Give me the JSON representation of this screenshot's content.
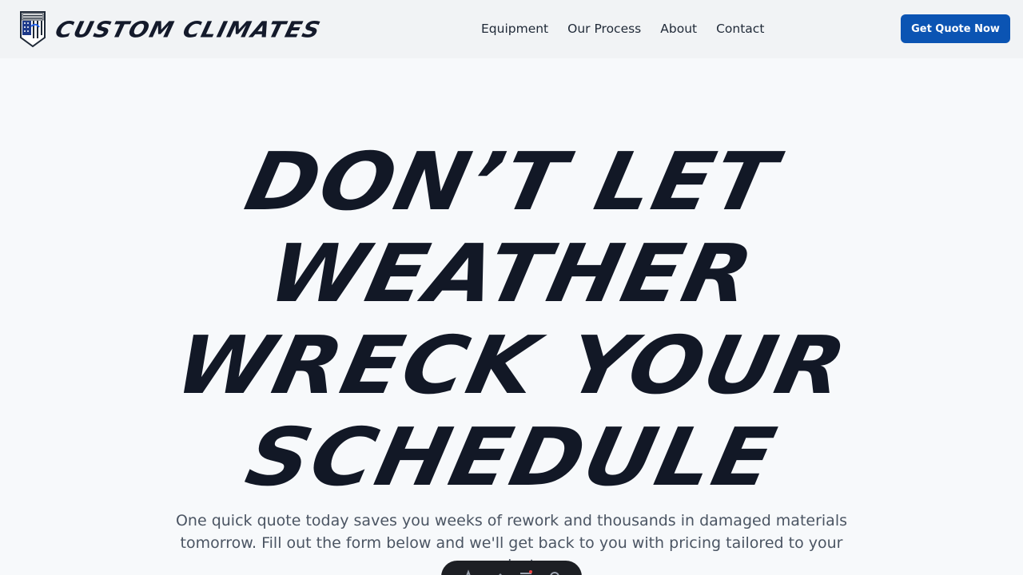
{
  "header": {
    "logo_text": "CUSTOM CLIMATES",
    "nav": [
      {
        "label": "Equipment"
      },
      {
        "label": "Our Process"
      },
      {
        "label": "About"
      },
      {
        "label": "Contact"
      }
    ],
    "cta_label": "Get Quote Now"
  },
  "hero": {
    "title_lines": [
      "DON’T LET",
      "WEATHER",
      "WRECK YOUR",
      "SCHEDULE"
    ],
    "subtitle": "One quick quote today saves you weeks of rework and thousands in damaged materials tomorrow. Fill out the form below and we'll get back to you with pricing tailored to your project."
  },
  "toolbar": {
    "icons": [
      "inspect-icon",
      "edit-icon",
      "menu-icon",
      "settings-icon"
    ]
  },
  "colors": {
    "accent": "#0b54b3",
    "text_dark": "#121826",
    "page_bg": "#f7f9fb",
    "header_bg": "#f1f3f5"
  }
}
